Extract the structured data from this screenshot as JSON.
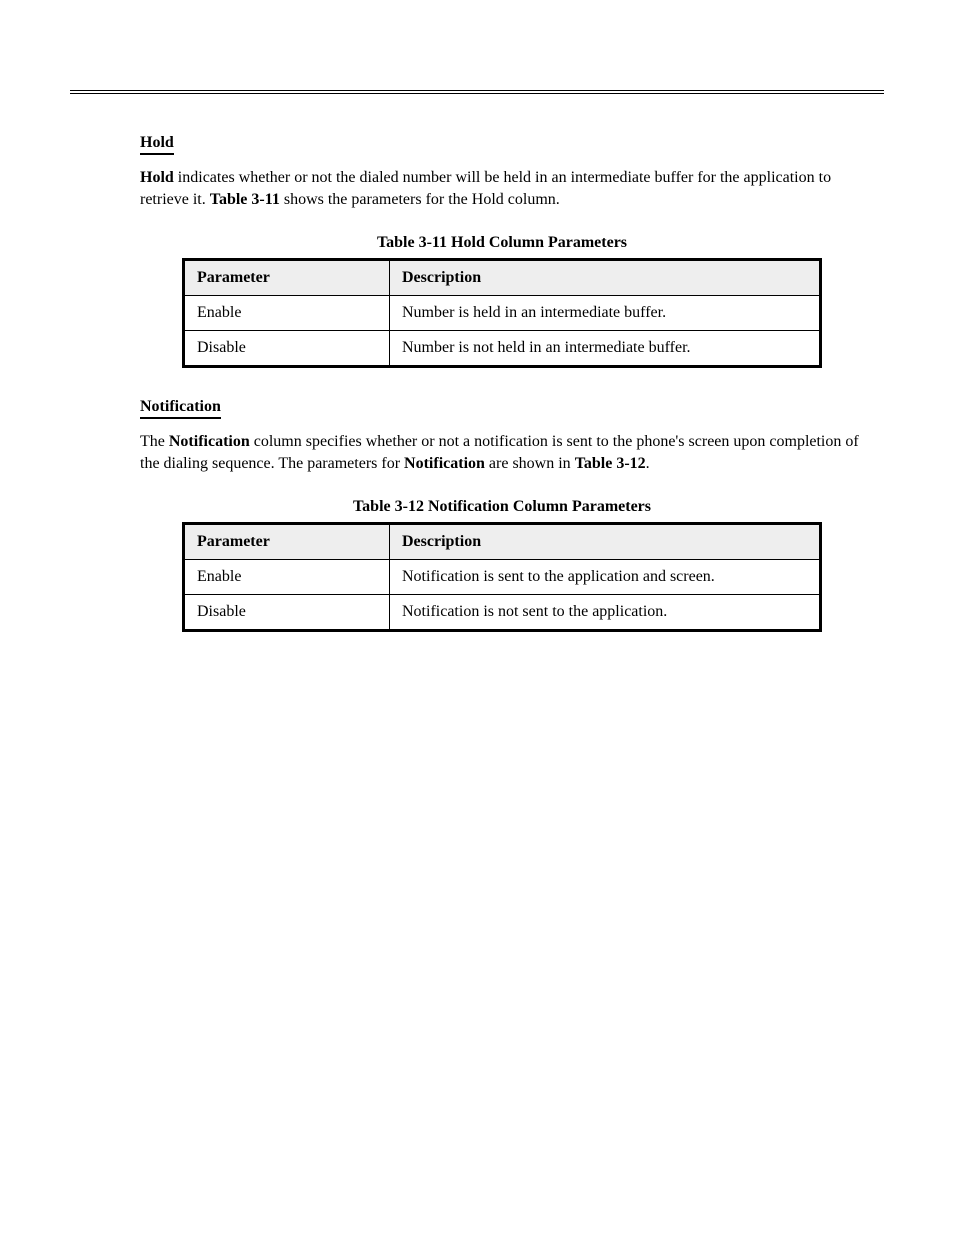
{
  "sections": [
    {
      "heading": "Hold",
      "paragraph_html": "[[Hold]] indicates whether or not the dialed number will be held in an intermediate buffer for the application to retrieve it. [[Table 3-11]] shows the parameters for the Hold column.",
      "table": {
        "caption": "Table 3-11   Hold Column Parameters",
        "headers": [
          "Parameter",
          "Description"
        ],
        "rows": [
          [
            "Enable",
            "Number is held in an intermediate buffer."
          ],
          [
            "Disable",
            "Number is not held in an intermediate buffer."
          ]
        ]
      }
    },
    {
      "heading": "Notification",
      "paragraph_html": "The [[Notification]] column specifies whether or not a notification is sent to the phone's screen upon completion of the dialing sequence. The parameters for [[Notification]] are shown in [[Table 3-12]].",
      "table": {
        "caption": "Table 3-12   Notification Column Parameters",
        "headers": [
          "Parameter",
          "Description"
        ],
        "rows": [
          [
            "Enable",
            "Notification is sent to the application and screen."
          ],
          [
            "Disable",
            "Notification is not sent to the application."
          ]
        ]
      }
    }
  ]
}
